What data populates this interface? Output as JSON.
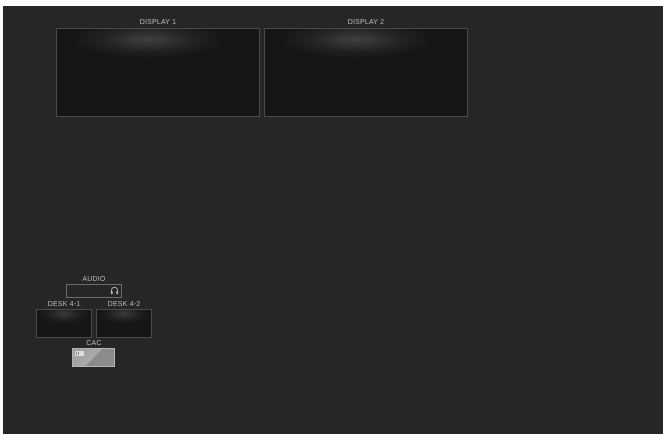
{
  "displays": [
    {
      "label": "DISPLAY 1"
    },
    {
      "label": "DISPLAY 2"
    }
  ],
  "audio": {
    "label": "AUDIO",
    "icon": "headphones-icon"
  },
  "desks": [
    {
      "label": "DESK 4-1"
    },
    {
      "label": "DESK 4-2"
    }
  ],
  "cac": {
    "label": "CAC",
    "icon": "card-icon"
  },
  "colors": {
    "background": "#262626",
    "screen": "#161616",
    "label": "#b9b9b9"
  }
}
